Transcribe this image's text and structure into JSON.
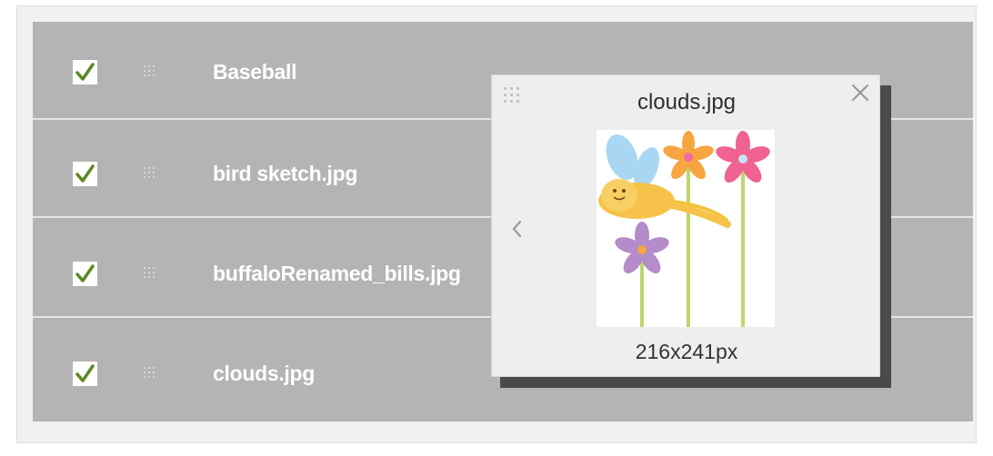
{
  "files": [
    {
      "name": "Baseball",
      "checked": true
    },
    {
      "name": "bird sketch.jpg",
      "checked": true
    },
    {
      "name": "buffaloRenamed_bills.jpg",
      "checked": true
    },
    {
      "name": "clouds.jpg",
      "checked": true
    }
  ],
  "preview": {
    "title": "clouds.jpg",
    "dimensions": "216x241px",
    "close_icon": "close-icon",
    "prev_icon": "chevron-left-icon",
    "drag_icon": "drag-handle-icon"
  },
  "colors": {
    "row_bg": "#b4b4b4",
    "check": "#5b8a21",
    "popup_bg": "#eeeeee"
  }
}
